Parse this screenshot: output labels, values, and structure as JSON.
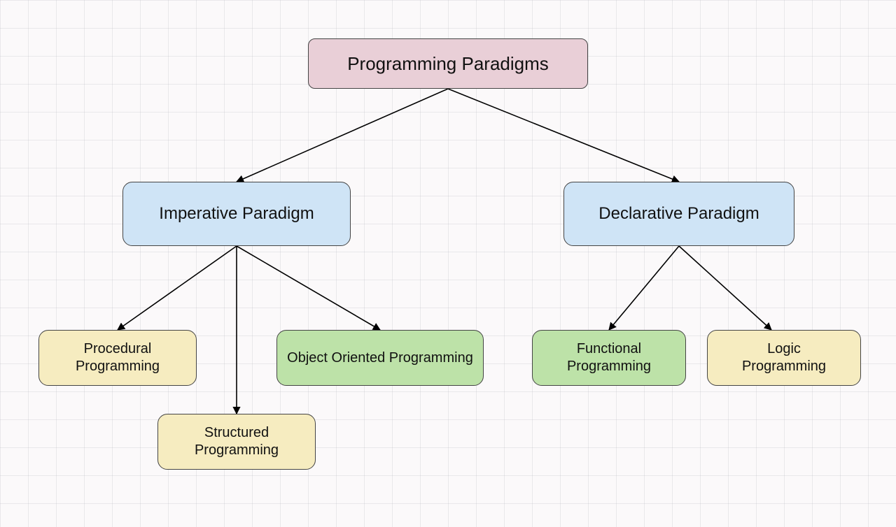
{
  "diagram": {
    "root": {
      "label": "Programming Paradigms"
    },
    "level2": {
      "imperative": {
        "label": "Imperative Paradigm"
      },
      "declarative": {
        "label": "Declarative Paradigm"
      }
    },
    "leaves": {
      "procedural": {
        "line1": "Procedural",
        "line2": "Programming"
      },
      "structured": {
        "line1": "Structured",
        "line2": "Programming"
      },
      "oop": {
        "label": "Object Oriented Programming"
      },
      "functional": {
        "line1": "Functional",
        "line2": "Programming"
      },
      "logic": {
        "line1": "Logic",
        "line2": "Programming"
      }
    }
  },
  "colors": {
    "root_bg": "#e9cfd7",
    "paradigm_bg": "#cfe4f6",
    "yellow_bg": "#f6ecc0",
    "green_bg": "#bde2a8",
    "border": "#444444",
    "canvas": "#fbf9fa"
  }
}
